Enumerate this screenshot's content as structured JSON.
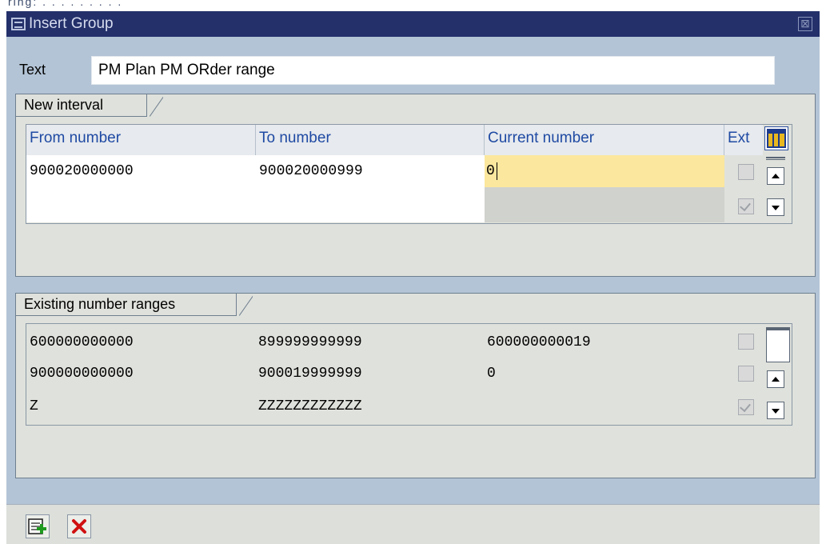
{
  "top_strip_text": "ring: . . . . . . . . .",
  "dialog": {
    "title": "Insert Group",
    "close_symbol": "⊠",
    "text_label": "Text",
    "text_value": "PM Plan PM ORder range"
  },
  "new_interval": {
    "group_title": "New interval",
    "headers": {
      "from": "From number",
      "to": "To number",
      "current": "Current number",
      "ext": "Ext"
    },
    "row": {
      "from": "900020000000",
      "to": "900020000999",
      "current": "0",
      "ext_checked": false
    },
    "second_row_ext_checked": true
  },
  "existing_ranges": {
    "group_title": "Existing number ranges",
    "rows": [
      {
        "from": "600000000000",
        "to": "899999999999",
        "current": "600000000019",
        "ext_checked": false
      },
      {
        "from": "900000000000",
        "to": "900019999999",
        "current": "0",
        "ext_checked": false
      },
      {
        "from": "Z",
        "to": "ZZZZZZZZZZZZ",
        "current": "",
        "ext_checked": true
      }
    ]
  },
  "footer": {
    "buttons": [
      "insert-icon",
      "cancel-icon"
    ]
  },
  "colors": {
    "title_bar": "#23306a",
    "window_bg": "#b3c4d6",
    "group_bg": "#dfe1dc",
    "header_text": "#1f4aa3",
    "active_cell": "#fbe79e",
    "cancel_red": "#d01010"
  }
}
